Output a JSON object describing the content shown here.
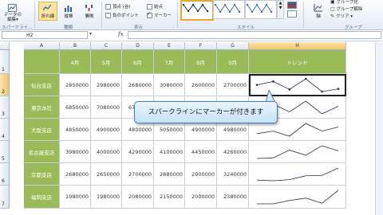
{
  "ribbon": {
    "data_edit": [
      "データの",
      "編集▾"
    ],
    "group_sparkline": "スパークライ...",
    "type_buttons": [
      "折れ線",
      "縦棒",
      "勝敗"
    ],
    "group_type": "種類",
    "checks": [
      {
        "label": "頂点 (谷)",
        "checked": false
      },
      {
        "label": "負のポイント",
        "checked": false
      },
      {
        "label": "始点",
        "checked": false
      },
      {
        "label": "マーカー",
        "checked": true
      }
    ],
    "group_show": "表示",
    "group_style": "スタイル",
    "axis_label": "軸",
    "group_label": "グループ化",
    "ungroup_label": "グループ解除",
    "clear_label": "クリア",
    "group_group": "グループ"
  },
  "formula_bar": {
    "name_box": "H2",
    "fx": "fx",
    "value": ""
  },
  "columns": [
    "A",
    "B",
    "C",
    "D",
    "E",
    "F",
    "G",
    "H"
  ],
  "selected_column": "H",
  "rows": [
    "1",
    "2",
    "3",
    "4",
    "5",
    "6",
    "7"
  ],
  "selected_row": "2",
  "table": {
    "headers": [
      "",
      "4月",
      "5月",
      "6月",
      "7月",
      "8月",
      "9月",
      "トレンド"
    ],
    "data": [
      {
        "branch": "仙台支店",
        "values": [
          "2850000",
          "2980000",
          "2680000",
          "3080000",
          "2600000",
          "2700000"
        ]
      },
      {
        "branch": "東京本社",
        "values": [
          "6850000",
          "7080000",
          "6780000",
          "",
          "",
          ""
        ]
      },
      {
        "branch": "大阪支店",
        "values": [
          "4850000",
          "4900000",
          "4800000",
          "5050000",
          "4900000",
          "4980000"
        ]
      },
      {
        "branch": "名古屋支店",
        "values": [
          "3980000",
          "4000000",
          "4290000",
          "4100000",
          "4450000",
          "4260000"
        ]
      },
      {
        "branch": "京都支店",
        "values": [
          "2680000",
          "2650000",
          "2700000",
          "2880000",
          "2900000",
          "3240000"
        ]
      },
      {
        "branch": "福岡支店",
        "values": [
          "1980000",
          "1980000",
          "2080000",
          "2150000",
          "2000000",
          "2380000"
        ]
      }
    ]
  },
  "sparkline_series": [
    [
      2850000,
      2980000,
      2680000,
      3080000,
      2600000,
      2700000
    ],
    [
      6850000,
      7080000,
      6780000,
      7200000,
      6700000,
      7000000
    ],
    [
      4850000,
      4900000,
      4800000,
      5050000,
      4900000,
      4980000
    ],
    [
      3980000,
      4000000,
      4290000,
      4100000,
      4450000,
      4260000
    ],
    [
      2680000,
      2650000,
      2700000,
      2880000,
      2900000,
      3240000
    ],
    [
      1980000,
      1980000,
      2080000,
      2150000,
      2000000,
      2380000
    ]
  ],
  "sparkline_markers": true,
  "callout_text": "スパークラインにマーカーが付きます",
  "colors": {
    "header_green": "#9bbb59",
    "sparkline": "#1f2f4a",
    "selection": "#e4a92a"
  }
}
